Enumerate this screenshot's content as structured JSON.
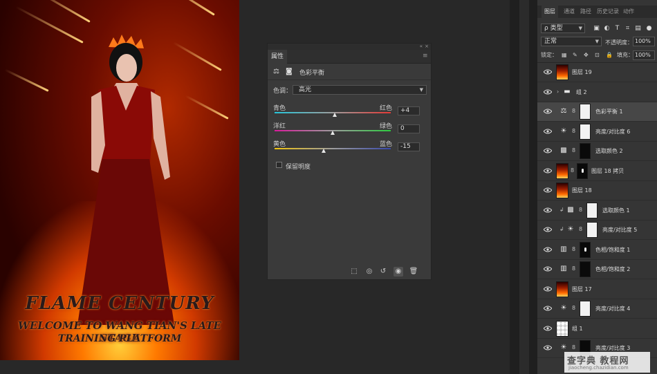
{
  "artwork": {
    "title": "FLAME CENTURY",
    "line2": "WELCOME TO WANG TIAN'S LATE STAGE",
    "line3": "TRAINING PLATFORM"
  },
  "properties": {
    "tab_label": "属性",
    "header_title": "色彩平衡",
    "tone_label": "色调：",
    "tone_value": "高光",
    "sliders": [
      {
        "left": "青色",
        "right": "红色",
        "value": "+4",
        "fraction": 0.52,
        "gradient": "linear-gradient(90deg,#26c6da,#9e9e9e,#e53935)"
      },
      {
        "left": "洋红",
        "right": "绿色",
        "value": "0",
        "fraction": 0.5,
        "gradient": "linear-gradient(90deg,#d81b9b,#9e9e9e,#2ecc40)"
      },
      {
        "left": "黄色",
        "right": "蓝色",
        "value": "-15",
        "fraction": 0.42,
        "gradient": "linear-gradient(90deg,#f1c40f,#9e9e9e,#3949ab)"
      }
    ],
    "preserve_label": "保留明度"
  },
  "layers_panel": {
    "tabs": [
      "图层",
      "通道",
      "路径",
      "历史记录",
      "动作"
    ],
    "filter_label": "ρ 类型",
    "blend_mode": "正常",
    "opacity_label": "不透明度：",
    "opacity_value": "100%",
    "lock_label": "锁定：",
    "fill_label": "填充：",
    "fill_value": "100%",
    "layers": [
      {
        "name": "图层 19",
        "kind": "image"
      },
      {
        "name": "组 2",
        "kind": "group"
      },
      {
        "name": "色彩平衡 1",
        "kind": "adj-balance",
        "mask": "white",
        "selected": true
      },
      {
        "name": "亮度/对比度 6",
        "kind": "adj-brightness",
        "mask": "white"
      },
      {
        "name": "选取颜色 2",
        "kind": "adj-selective",
        "mask": "black"
      },
      {
        "name": "图层 18 拷贝",
        "kind": "image-mask"
      },
      {
        "name": "图层 18",
        "kind": "image"
      },
      {
        "name": "选取颜色 1",
        "kind": "adj-selective",
        "mask": "white",
        "clip": true
      },
      {
        "name": "亮度/对比度 5",
        "kind": "adj-brightness",
        "mask": "white",
        "clip": true
      },
      {
        "name": "色相/饱和度 1",
        "kind": "adj-hue",
        "mask": "black"
      },
      {
        "name": "色相/饱和度 2",
        "kind": "adj-hue",
        "mask": "black"
      },
      {
        "name": "图层 17",
        "kind": "image"
      },
      {
        "name": "亮度/对比度 4",
        "kind": "adj-brightness",
        "mask": "white"
      },
      {
        "name": "组 1",
        "kind": "group-check"
      },
      {
        "name": "亮度/对比度 3",
        "kind": "adj-brightness",
        "mask": "black"
      }
    ]
  },
  "watermark": {
    "line1": "查字典 教程网",
    "line2": "jiaocheng.chazidian.com"
  }
}
